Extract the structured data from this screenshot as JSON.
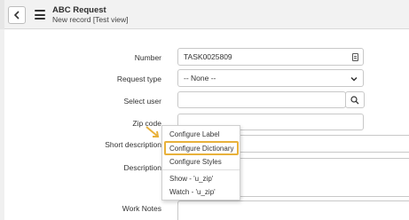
{
  "header": {
    "title": "ABC Request",
    "subtitle": "New record [Test view]"
  },
  "form": {
    "number_label": "Number",
    "number_value": "TASK0025809",
    "request_type_label": "Request type",
    "request_type_value": "-- None --",
    "select_user_label": "Select user",
    "select_user_value": "",
    "zip_code_label": "Zip code",
    "short_description_label": "Short description",
    "description_label": "Description",
    "work_notes_label": "Work Notes"
  },
  "context_menu": {
    "items": [
      {
        "label": "Configure Label"
      },
      {
        "label": "Configure Dictionary"
      },
      {
        "label": "Configure Styles"
      },
      {
        "label": "Show - 'u_zip'"
      },
      {
        "label": "Watch - 'u_zip'"
      }
    ]
  },
  "colors": {
    "highlight": "#e8b13b",
    "arrow": "#e8b13b"
  },
  "icons": [
    "back-icon",
    "hamburger-menu-icon",
    "document-icon",
    "chevron-down-icon",
    "search-icon",
    "arrow-pointer-icon"
  ]
}
